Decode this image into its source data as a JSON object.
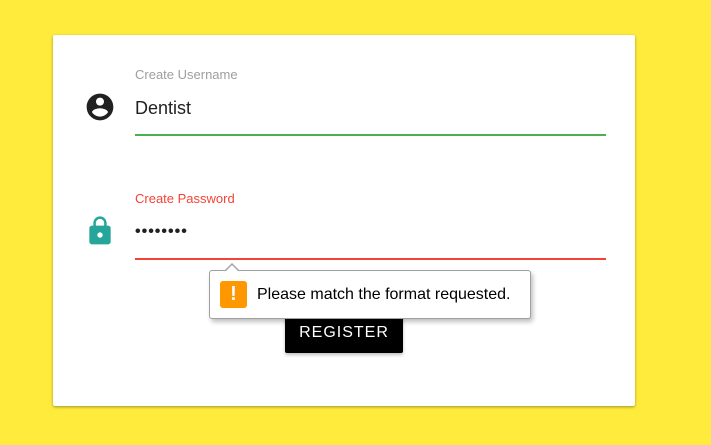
{
  "form": {
    "username": {
      "label": "Create Username",
      "value": "Dentist",
      "icon": "account-circle-icon",
      "underline_color": "#4caf50"
    },
    "password": {
      "label": "Create Password",
      "value": "••••••••",
      "icon": "lock-icon",
      "icon_color": "#26a69a",
      "underline_color": "#f44336"
    },
    "register_label": "REGISTER"
  },
  "validation_tooltip": {
    "message": "Please match the format requested.",
    "icon": "warning-icon",
    "icon_glyph": "!",
    "icon_color": "#ff9800"
  },
  "colors": {
    "background": "#ffeb3b",
    "error": "#f44336",
    "success": "#4caf50"
  }
}
